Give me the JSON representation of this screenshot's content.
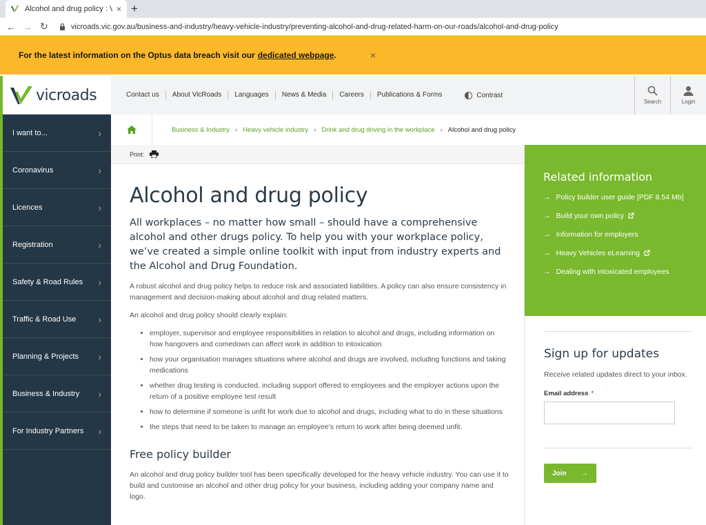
{
  "browser": {
    "tab_title": "Alcohol and drug policy : VicRoa",
    "tab_close": "×",
    "new_tab": "+",
    "url": "vicroads.vic.gov.au/business-and-industry/heavy-vehicle-industry/preventing-alcohol-and-drug-related-harm-on-our-roads/alcohol-and-drug-policy"
  },
  "alert": {
    "text": "For the latest information on the Optus data breach visit our",
    "link": "dedicated webpage",
    "suffix": ".",
    "close": "×"
  },
  "header": {
    "logo_text": "vicroads",
    "links": [
      "Contact us",
      "About VicRoads",
      "Languages",
      "News & Media",
      "Careers",
      "Publications & Forms"
    ],
    "contrast": "Contrast",
    "search": "Search",
    "login": "Login"
  },
  "sidebar": {
    "items": [
      "I want to...",
      "Coronavirus",
      "Licences",
      "Registration",
      "Safety & Road Rules",
      "Traffic & Road Use",
      "Planning & Projects",
      "Business & Industry",
      "For Industry Partners"
    ]
  },
  "breadcrumb": {
    "items": [
      "Business & Industry",
      "Heavy vehicle industry",
      "Drink and drug driving in the workplace"
    ],
    "current": "Alcohol and drug policy",
    "separator": "›"
  },
  "print": {
    "label": "Print:"
  },
  "main": {
    "title": "Alcohol and drug policy",
    "lead": "All workplaces – no matter how small – should have a comprehensive alcohol and other drugs policy. To help you with your workplace policy, we’ve created a simple online toolkit with input from industry experts and the Alcohol and Drug Foundation.",
    "para1": "A robust alcohol and drug policy helps to reduce risk and associated liabilities. A policy can also ensure consistency in management and decision-making about alcohol and drug related matters.",
    "para2": "An alcohol and drug policy should clearly explain:",
    "bullets": [
      "employer, supervisor and employee responsibilities in relation to alcohol and drugs, including information on how hangovers and comedown can affect work in addition to intoxication",
      "how your organisation manages situations where alcohol and drugs are involved, including functions and taking medications",
      "whether drug testing is conducted, including support offered to employees and the employer actions upon the return of a positive employee test result",
      "how to determine if someone is unfit for work due to alcohol and drugs, including what to do in these situations",
      "the steps that need to be taken to manage an employee’s return to work after being deemed unfit."
    ],
    "sub_heading": "Free policy builder",
    "para3": "An alcohol and drug policy builder tool has been specifically developed for the heavy vehicle industry. You can use it to build and customise an alcohol and other drug policy for your business, including adding your company name and logo."
  },
  "related": {
    "title": "Related information",
    "arrow": "→",
    "items": [
      {
        "label": "Policy builder user guide [PDF 8.54 Mb]",
        "external": false
      },
      {
        "label": "Build your own policy",
        "external": true
      },
      {
        "label": "Information for employers",
        "external": false
      },
      {
        "label": "Heavy Vehicles eLearning",
        "external": true
      },
      {
        "label": "Dealing with intoxicated employees",
        "external": false
      }
    ]
  },
  "signup": {
    "title": "Sign up for updates",
    "desc": "Receive related updates direct to your inbox.",
    "email_label": "Email address",
    "required_mark": "*",
    "email_value": "",
    "join_label": "Join",
    "join_arrow": "→"
  },
  "colors": {
    "alert_bg": "#fbb829",
    "brand_green": "#7ab82e",
    "sidebar_bg": "#243746",
    "link_green": "#5a9e1f"
  }
}
